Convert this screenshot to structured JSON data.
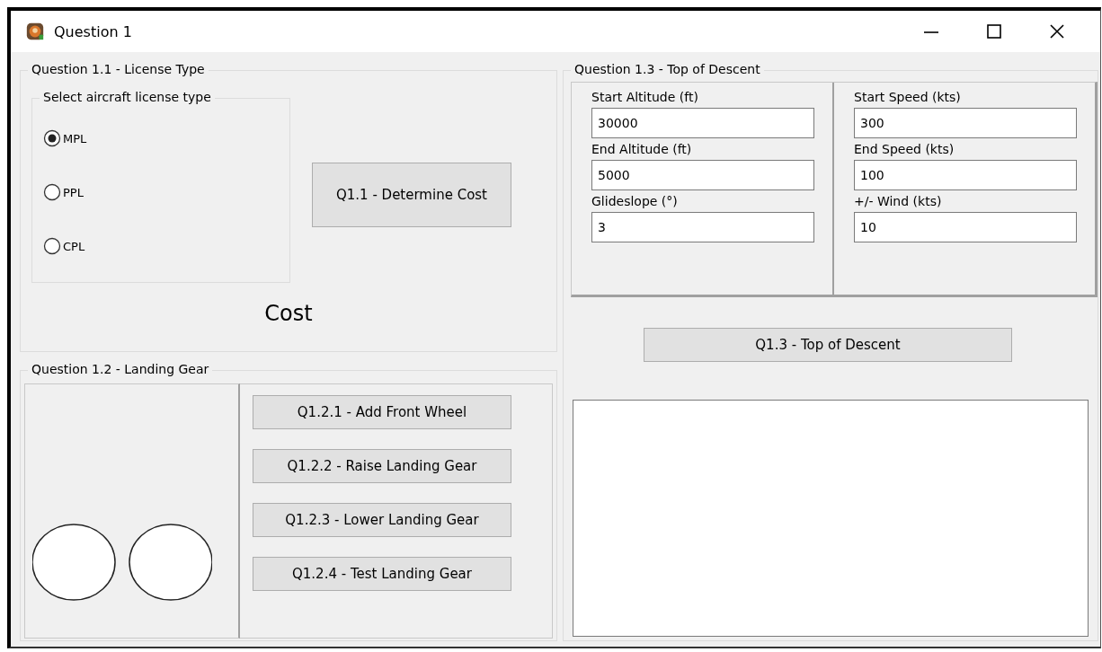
{
  "window": {
    "title": "Question 1"
  },
  "license_group": {
    "title": "Question 1.1 - License Type",
    "radio_group": {
      "title": "Select aircraft license type",
      "options": [
        {
          "label": "MPL",
          "selected": true
        },
        {
          "label": "PPL",
          "selected": false
        },
        {
          "label": "CPL",
          "selected": false
        }
      ]
    },
    "button": "Q1.1 - Determine Cost",
    "result": "Cost"
  },
  "landing_gear_group": {
    "title": "Question 1.2 - Landing Gear",
    "buttons": [
      "Q1.2.1 - Add Front Wheel",
      "Q1.2.2 - Raise Landing Gear",
      "Q1.2.3 - Lower Landing Gear",
      "Q1.2.4 - Test Landing Gear"
    ]
  },
  "descent_group": {
    "title": "Question 1.3 - Top of Descent",
    "columns": [
      [
        {
          "label": "Start Altitude (ft)",
          "value": "30000"
        },
        {
          "label": "End Altitude (ft)",
          "value": "5000"
        },
        {
          "label": "Glideslope (°)",
          "value": "3"
        }
      ],
      [
        {
          "label": "Start Speed (kts)",
          "value": "300"
        },
        {
          "label": "End Speed (kts)",
          "value": "100"
        },
        {
          "label": "+/- Wind (kts)",
          "value": "10"
        }
      ]
    ],
    "button": "Q1.3 - Top of Descent"
  }
}
